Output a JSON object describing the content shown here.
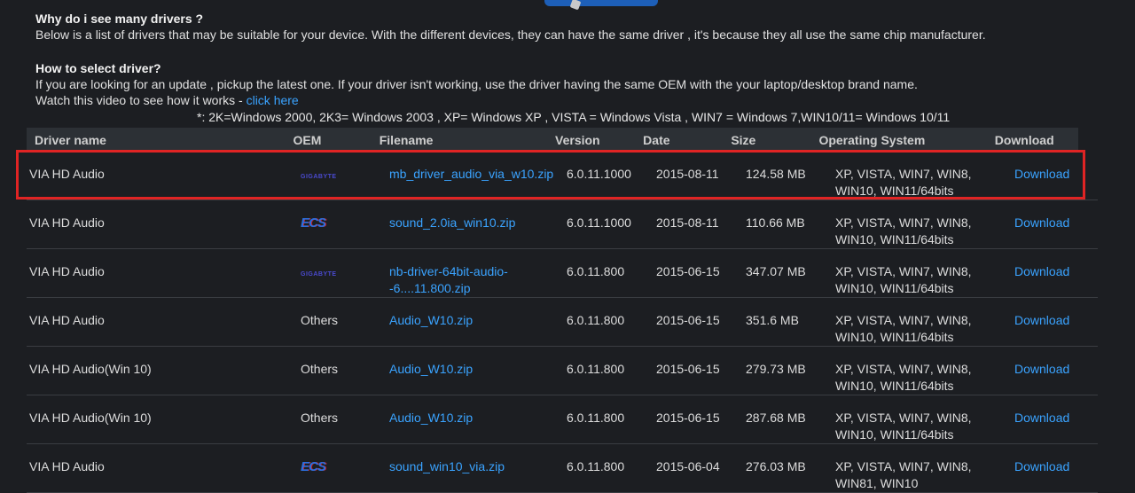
{
  "info": {
    "q1_title": "Why do i see many drivers ?",
    "q1_text": "Below is a list of drivers that may be suitable for your device. With the different devices, they can have the same driver , it's because they all use the same chip manufacturer.",
    "q2_title": "How to select driver?",
    "q2_text": "If you are looking for an update , pickup the latest one. If your driver isn't working, use the driver having the same OEM with the your laptop/desktop brand name.",
    "video_text": "Watch this video to see how it works - ",
    "video_link": "click here",
    "legend": "*: 2K=Windows 2000, 2K3= Windows 2003 , XP= Windows XP , VISTA = Windows Vista , WIN7 = Windows 7,WIN10/11= Windows 10/11"
  },
  "table": {
    "headers": {
      "name": "Driver name",
      "oem": "OEM",
      "filename": "Filename",
      "version": "Version",
      "date": "Date",
      "size": "Size",
      "os": "Operating System",
      "download": "Download"
    },
    "rows": [
      {
        "name": "VIA HD Audio",
        "oem_logo": "gigabyte-logo",
        "oem_text": "GIGABYTE",
        "filename": "mb_driver_audio_via_w10.zip",
        "version": "6.0.11.1000",
        "date": "2015-08-11",
        "size": "124.58 MB",
        "os_line1": "XP, VISTA, WIN7, WIN8,",
        "os_line2": "WIN10, WIN11/64bits",
        "download": "Download"
      },
      {
        "name": "VIA HD Audio",
        "oem_logo": "ecs-logo",
        "oem_text": "ECS",
        "filename": "sound_2.0ia_win10.zip",
        "version": "6.0.11.1000",
        "date": "2015-08-11",
        "size": "110.66 MB",
        "os_line1": "XP, VISTA, WIN7, WIN8,",
        "os_line2": "WIN10, WIN11/64bits",
        "download": "Download"
      },
      {
        "name": "VIA HD Audio",
        "oem_logo": "gigabyte-logo",
        "oem_text": "GIGABYTE",
        "filename": "nb-driver-64bit-audio-",
        "filename2": "-6....11.800.zip",
        "version": "6.0.11.800",
        "date": "2015-06-15",
        "size": "347.07 MB",
        "os_line1": "XP, VISTA, WIN7, WIN8,",
        "os_line2": "WIN10, WIN11/64bits",
        "download": "Download"
      },
      {
        "name": "VIA HD Audio",
        "oem_text_plain": "Others",
        "filename": "Audio_W10.zip",
        "version": "6.0.11.800",
        "date": "2015-06-15",
        "size": "351.6 MB",
        "os_line1": "XP, VISTA, WIN7, WIN8,",
        "os_line2": "WIN10, WIN11/64bits",
        "download": "Download"
      },
      {
        "name": "VIA HD Audio(Win 10)",
        "oem_text_plain": "Others",
        "filename": "Audio_W10.zip",
        "version": "6.0.11.800",
        "date": "2015-06-15",
        "size": "279.73 MB",
        "os_line1": "XP, VISTA, WIN7, WIN8,",
        "os_line2": "WIN10, WIN11/64bits",
        "download": "Download"
      },
      {
        "name": "VIA HD Audio(Win 10)",
        "oem_text_plain": "Others",
        "filename": "Audio_W10.zip",
        "version": "6.0.11.800",
        "date": "2015-06-15",
        "size": "287.68 MB",
        "os_line1": "XP, VISTA, WIN7, WIN8,",
        "os_line2": "WIN10, WIN11/64bits",
        "download": "Download"
      },
      {
        "name": "VIA HD Audio",
        "oem_logo": "ecs-logo",
        "oem_text": "ECS",
        "filename": "sound_win10_via.zip",
        "version": "6.0.11.800",
        "date": "2015-06-04",
        "size": "276.03 MB",
        "os_line1": "XP, VISTA, WIN7, WIN8,",
        "os_line2": "WIN81, WIN10",
        "download": "Download"
      }
    ]
  },
  "colors": {
    "background": "#1c1e22",
    "header_bg": "#2c3035",
    "link": "#3aa3ff",
    "highlight": "#e02424"
  }
}
